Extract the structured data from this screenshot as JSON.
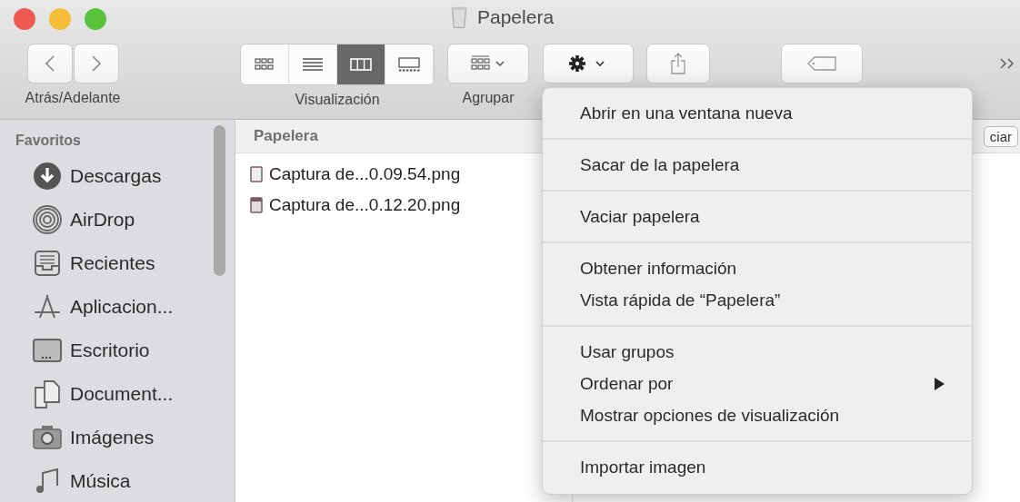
{
  "window": {
    "title": "Papelera"
  },
  "toolbar": {
    "nav_label": "Atrás/Adelante",
    "view_label": "Visualización",
    "group_label": "Agrupar",
    "view_modes": [
      {
        "kind": "icons",
        "selected": false
      },
      {
        "kind": "list",
        "selected": false
      },
      {
        "kind": "columns",
        "selected": true
      },
      {
        "kind": "gallery",
        "selected": false
      }
    ]
  },
  "sidebar": {
    "heading": "Favoritos",
    "items": [
      {
        "label": "Descargas",
        "kind": "downloads"
      },
      {
        "label": "AirDrop",
        "kind": "airdrop"
      },
      {
        "label": "Recientes",
        "kind": "recents"
      },
      {
        "label": "Aplicacion...",
        "kind": "apps"
      },
      {
        "label": "Escritorio",
        "kind": "desktop"
      },
      {
        "label": "Document...",
        "kind": "documents"
      },
      {
        "label": "Imágenes",
        "kind": "pictures"
      },
      {
        "label": "Música",
        "kind": "music"
      }
    ]
  },
  "column": {
    "header": "Papelera",
    "header_button": "ciar",
    "files": [
      {
        "name": "Captura de...0.09.54.png"
      },
      {
        "name": "Captura de...0.12.20.png"
      }
    ]
  },
  "menu": {
    "sections": [
      [
        {
          "label": "Abrir en una ventana nueva",
          "submenu": false
        }
      ],
      [
        {
          "label": "Sacar de la papelera",
          "submenu": false
        }
      ],
      [
        {
          "label": "Vaciar papelera",
          "submenu": false
        }
      ],
      [
        {
          "label": "Obtener información",
          "submenu": false
        },
        {
          "label": "Vista rápida de “Papelera”",
          "submenu": false
        }
      ],
      [
        {
          "label": "Usar grupos",
          "submenu": false
        },
        {
          "label": "Ordenar por",
          "submenu": true
        },
        {
          "label": "Mostrar opciones de visualización",
          "submenu": false
        }
      ],
      [
        {
          "label": "Importar imagen",
          "submenu": false
        }
      ]
    ]
  }
}
